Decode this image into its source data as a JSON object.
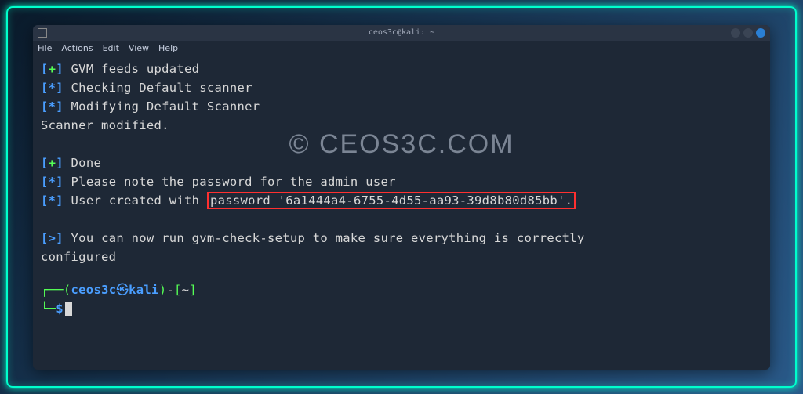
{
  "titlebar": {
    "title": "ceos3c@kali: ~"
  },
  "menubar": {
    "file": "File",
    "actions": "Actions",
    "edit": "Edit",
    "view": "View",
    "help": "Help"
  },
  "output": {
    "l1": {
      "sym": "+",
      "text": " GVM feeds updated"
    },
    "l2": {
      "sym": "*",
      "text": " Checking Default scanner"
    },
    "l3": {
      "sym": "*",
      "text": " Modifying Default Scanner"
    },
    "l4": "Scanner modified.",
    "l5": {
      "sym": "+",
      "text": " Done"
    },
    "l6": {
      "sym": "*",
      "text": " Please note the password for the admin user"
    },
    "l7": {
      "sym": "*",
      "pre": " User created with ",
      "hl": "password '6a1444a4-6755-4d55-aa93-39d8b80d85bb'."
    },
    "l8": {
      "sym": ">",
      "text": " You can now run gvm-check-setup to make sure everything is correctly "
    },
    "l8b": "configured"
  },
  "prompt": {
    "user": "ceos3c",
    "host": "kali",
    "path": "~",
    "dollar": "$"
  },
  "watermark": "© CEOS3C.COM"
}
